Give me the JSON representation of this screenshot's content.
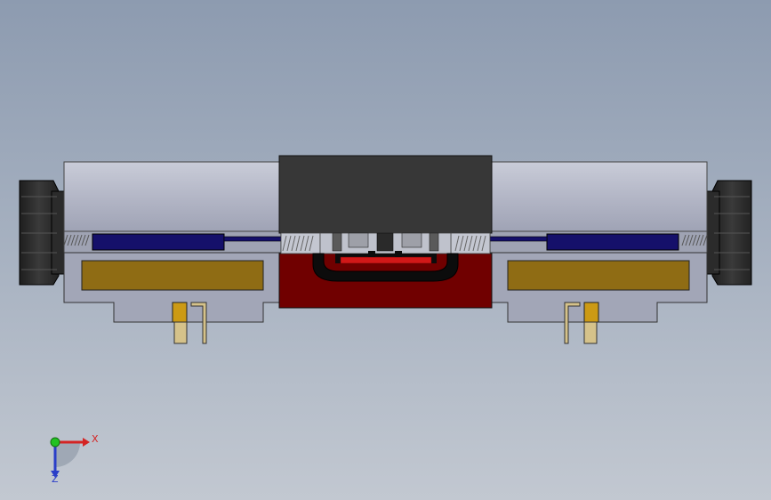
{
  "scene": {
    "background_top": "#8d9bb0",
    "background_bottom": "#c2c8d1"
  },
  "part_colors": {
    "housing": "#a2a6b7",
    "cylinder": "#b5b8c7",
    "center_block": "#373737",
    "center_base": "#700000",
    "coil_insert": "#8f6c14",
    "spool_channel": "#15106a",
    "knob": "#2a2a2a",
    "pin": "#d5c28a"
  },
  "triad": {
    "x_label": "X",
    "z_label": "Z",
    "x_color": "#d42424",
    "y_color": "#22c222",
    "z_color": "#2a3ec8"
  }
}
